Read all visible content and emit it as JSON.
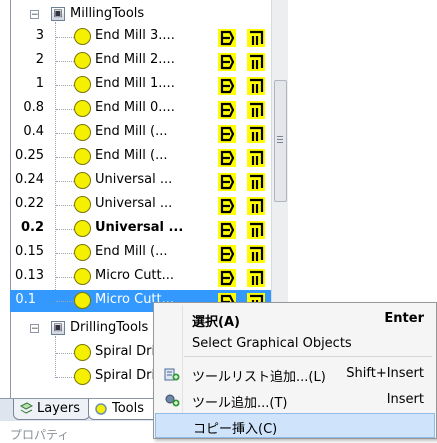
{
  "tree": {
    "groups": [
      {
        "label": "MillingTools",
        "expander": "−"
      },
      {
        "label": "DrillingTools",
        "expander": "−"
      }
    ],
    "milling_items": [
      {
        "name": "End Mill 3....",
        "value": "3",
        "bold": false
      },
      {
        "name": "End Mill 2....",
        "value": "2",
        "bold": false
      },
      {
        "name": "End Mill 1....",
        "value": "1",
        "bold": false
      },
      {
        "name": "End Mill 0....",
        "value": "0.8",
        "bold": false
      },
      {
        "name": "End Mill (...",
        "value": "0.4",
        "bold": false
      },
      {
        "name": "End Mill (...",
        "value": "0.25",
        "bold": false
      },
      {
        "name": "Universal ...",
        "value": "0.24",
        "bold": false
      },
      {
        "name": "Universal ...",
        "value": "0.22",
        "bold": false
      },
      {
        "name": "Universal ...",
        "value": "0.2",
        "bold": true
      },
      {
        "name": "End Mill (...",
        "value": "0.15",
        "bold": false
      },
      {
        "name": "Micro Cutt...",
        "value": "0.13",
        "bold": false
      },
      {
        "name": "Micro Cutt...",
        "value": "0.1",
        "bold": false,
        "selected": true
      }
    ],
    "drilling_items": [
      {
        "name": "Spiral Dri"
      },
      {
        "name": "Spiral Dri"
      }
    ]
  },
  "context_menu": {
    "items": [
      {
        "label": "選択(A)",
        "shortcut": "Enter",
        "bold": true,
        "icon": ""
      },
      {
        "label": "Select Graphical Objects",
        "shortcut": "",
        "bold": false,
        "icon": ""
      },
      {
        "label": "ツールリスト追加...(L)",
        "shortcut": "Shift+Insert",
        "bold": false,
        "icon": "add-tool-list-icon"
      },
      {
        "label": "ツール追加...(T)",
        "shortcut": "Insert",
        "bold": false,
        "icon": "add-tool-icon"
      },
      {
        "label": "コピー挿入(C)",
        "shortcut": "",
        "bold": false,
        "icon": "",
        "hover": true
      }
    ]
  },
  "tabs": {
    "layers": "Layers",
    "tools": "Tools"
  },
  "panel": {
    "properties_label": "プロパティ"
  },
  "colors": {
    "selection": "#3399ff",
    "tool_dot": "#f4f000",
    "menu_hover": "#cfe4fb"
  }
}
